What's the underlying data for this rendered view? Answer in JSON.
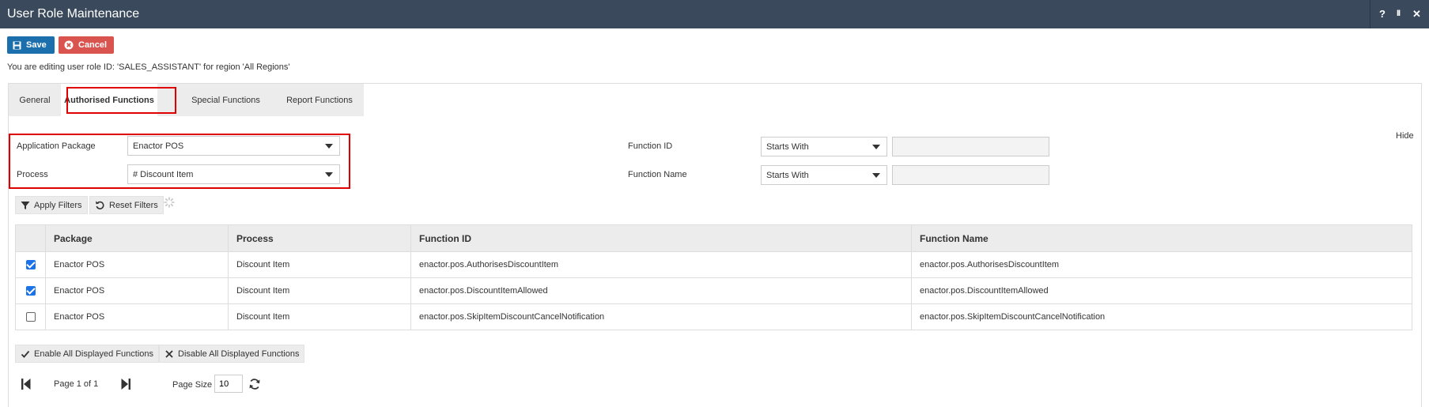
{
  "window": {
    "title": "User Role Maintenance",
    "help": "?",
    "pause": "II",
    "close": "✕"
  },
  "toolbar": {
    "save_label": "Save",
    "cancel_label": "Cancel"
  },
  "edit_message": "You are editing user role ID: 'SALES_ASSISTANT' for region 'All Regions'",
  "tabs": [
    {
      "label": "General"
    },
    {
      "label": "Authorised Functions"
    },
    {
      "label": "Special Functions"
    },
    {
      "label": "Report Functions"
    }
  ],
  "active_tab": "Authorised Functions",
  "filters": {
    "hide_label": "Hide",
    "application_package": {
      "label": "Application Package",
      "value": "Enactor POS"
    },
    "process": {
      "label": "Process",
      "value": "# Discount Item"
    },
    "function_id": {
      "label": "Function ID",
      "operator": "Starts With",
      "value": ""
    },
    "function_name": {
      "label": "Function Name",
      "operator": "Starts With",
      "value": ""
    },
    "apply_label": "Apply Filters",
    "reset_label": "Reset Filters"
  },
  "table": {
    "columns": [
      "Package",
      "Process",
      "Function ID",
      "Function Name"
    ],
    "rows": [
      {
        "checked": true,
        "package": "Enactor POS",
        "process": "Discount Item",
        "function_id": "enactor.pos.AuthorisesDiscountItem",
        "function_name": "enactor.pos.AuthorisesDiscountItem"
      },
      {
        "checked": true,
        "package": "Enactor POS",
        "process": "Discount Item",
        "function_id": "enactor.pos.DiscountItemAllowed",
        "function_name": "enactor.pos.DiscountItemAllowed"
      },
      {
        "checked": false,
        "package": "Enactor POS",
        "process": "Discount Item",
        "function_id": "enactor.pos.SkipItemDiscountCancelNotification",
        "function_name": "enactor.pos.SkipItemDiscountCancelNotification"
      }
    ]
  },
  "bulk": {
    "enable_label": "Enable All Displayed Functions",
    "disable_label": "Disable All Displayed Functions"
  },
  "pager": {
    "page_text": "Page 1 of 1",
    "page_size_label": "Page Size",
    "page_size": "10"
  },
  "colors": {
    "titlebar": "#3a4a5c",
    "save": "#1c6fad",
    "cancel": "#d9534f",
    "highlight": "#e00000",
    "checkbox": "#1a73e8"
  }
}
